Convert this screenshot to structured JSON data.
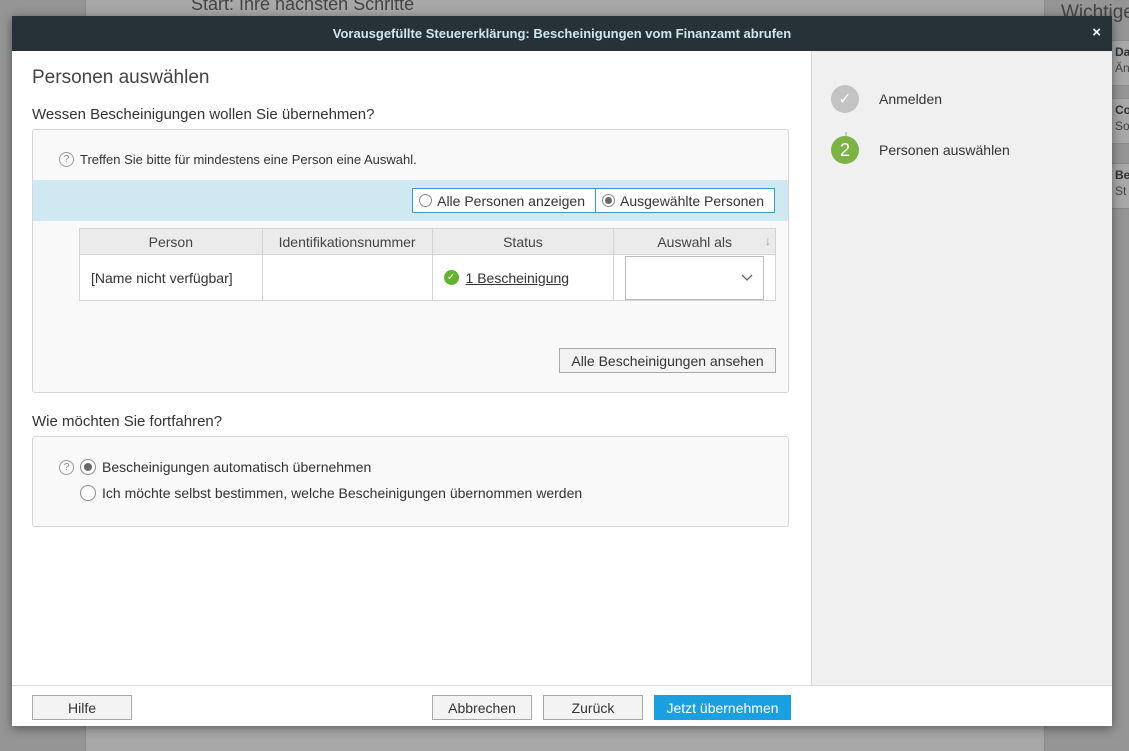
{
  "background": {
    "heading": "Start: Ihre nächsten Schritte",
    "right_title": "Wichtige",
    "cards": [
      {
        "title": "Da",
        "sub": "Än"
      },
      {
        "title": "Co",
        "sub": "So"
      },
      {
        "title": "Be",
        "sub": "St"
      }
    ]
  },
  "dialog": {
    "title": "Vorausgefüllte Steuererklärung: Bescheinigungen vom Finanzamt abrufen",
    "close_glyph": "×",
    "page_title": "Personen auswählen",
    "section1_label": "Wessen Bescheinigungen wollen Sie übernehmen?",
    "hint": "Treffen Sie bitte für mindestens eine Person eine Auswahl.",
    "help_glyph": "?",
    "filter": {
      "options": [
        "Alle Personen anzeigen",
        "Ausgewählte Personen"
      ],
      "selected": "Ausgewählte Personen"
    },
    "table": {
      "columns": [
        "Person",
        "Identifikationsnummer",
        "Status",
        "Auswahl als"
      ],
      "sort_glyph": "↓",
      "rows": [
        {
          "person": "[Name nicht verfügbar]",
          "id": "",
          "status": "1 Bescheinigung",
          "selection": ""
        }
      ]
    },
    "view_all_button": "Alle Bescheinigungen ansehen",
    "section2_label": "Wie möchten Sie fortfahren?",
    "proceed_options": [
      {
        "label": "Bescheinigungen automatisch übernehmen",
        "checked": true
      },
      {
        "label": "Ich möchte selbst bestimmen, welche Bescheinigungen übernommen werden",
        "checked": false
      }
    ]
  },
  "steps": [
    {
      "number": "✓",
      "label": "Anmelden",
      "state": "done"
    },
    {
      "number": "2",
      "label": "Personen auswählen",
      "state": "active"
    }
  ],
  "footer": {
    "help": "Hilfe",
    "cancel": "Abbrechen",
    "back": "Zurück",
    "apply": "Jetzt übernehmen"
  },
  "colors": {
    "titlebar": "#263238",
    "accent": "#1a9fe0",
    "step_active": "#7cb342",
    "status_ok": "#64b32d",
    "filter_bar": "#cfe8f1"
  }
}
